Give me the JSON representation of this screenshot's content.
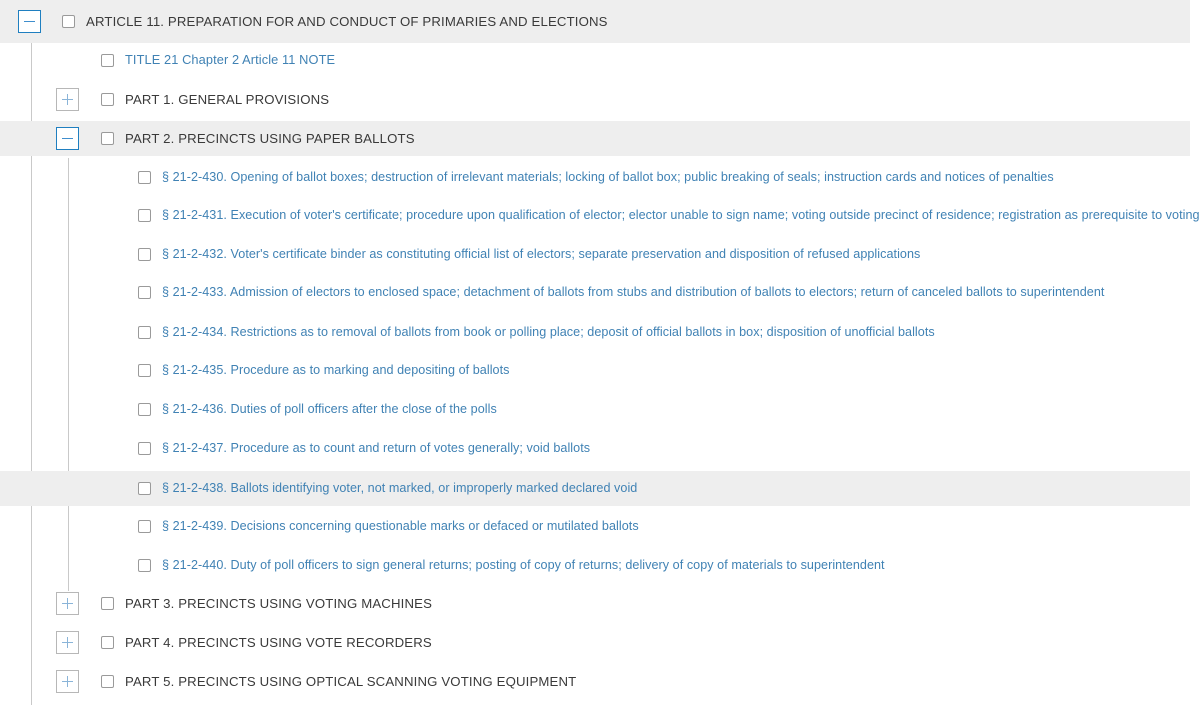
{
  "tree": {
    "article": {
      "toggle": "minus",
      "label": "ARTICLE 11. PREPARATION FOR AND CONDUCT OF PRIMARIES AND ELECTIONS",
      "highlighted": true
    },
    "note": {
      "label": "TITLE 21 Chapter 2 Article 11 NOTE"
    },
    "parts": [
      {
        "toggle": "plus",
        "label": "PART 1. GENERAL PROVISIONS",
        "highlighted": false
      },
      {
        "toggle": "minus",
        "label": "PART 2. PRECINCTS USING PAPER BALLOTS",
        "highlighted": true
      },
      {
        "toggle": "plus",
        "label": "PART 3. PRECINCTS USING VOTING MACHINES",
        "highlighted": false
      },
      {
        "toggle": "plus",
        "label": "PART 4. PRECINCTS USING VOTE RECORDERS",
        "highlighted": false
      },
      {
        "toggle": "plus",
        "label": "PART 5. PRECINCTS USING OPTICAL SCANNING VOTING EQUIPMENT",
        "highlighted": false
      }
    ],
    "sections": [
      {
        "label": "§ 21-2-430. Opening of ballot boxes; destruction of irrelevant materials; locking of ballot box; public breaking of seals; instruction cards and notices of penalties",
        "highlighted": false
      },
      {
        "label": "§ 21-2-431. Execution of voter's certificate; procedure upon qualification of elector; elector unable to sign name; voting outside precinct of residence; registration as prerequisite to voting",
        "highlighted": false
      },
      {
        "label": "§ 21-2-432. Voter's certificate binder as constituting official list of electors; separate preservation and disposition of refused applications",
        "highlighted": false
      },
      {
        "label": "§ 21-2-433. Admission of electors to enclosed space; detachment of ballots from stubs and distribution of ballots to electors; return of canceled ballots to superintendent",
        "highlighted": false
      },
      {
        "label": "§ 21-2-434. Restrictions as to removal of ballots from book or polling place; deposit of official ballots in box; disposition of unofficial ballots",
        "highlighted": false
      },
      {
        "label": "§ 21-2-435. Procedure as to marking and depositing of ballots",
        "highlighted": false
      },
      {
        "label": "§ 21-2-436. Duties of poll officers after the close of the polls",
        "highlighted": false
      },
      {
        "label": "§ 21-2-437. Procedure as to count and return of votes generally; void ballots",
        "highlighted": false
      },
      {
        "label": "§ 21-2-438. Ballots identifying voter, not marked, or improperly marked declared void",
        "highlighted": true
      },
      {
        "label": "§ 21-2-439. Decisions concerning questionable marks or defaced or mutilated ballots",
        "highlighted": false
      },
      {
        "label": "§ 21-2-440. Duty of poll officers to sign general returns; posting of copy of returns; delivery of copy of materials to superintendent",
        "highlighted": false
      }
    ]
  },
  "colors": {
    "link": "#4082b4",
    "heading": "#3a3a3a",
    "highlight_band": "#eeeeee",
    "toggle_active_border": "#1f7fc0",
    "toggle_inactive_border": "#b7b7b7",
    "guide_line": "#c9c9c9"
  }
}
